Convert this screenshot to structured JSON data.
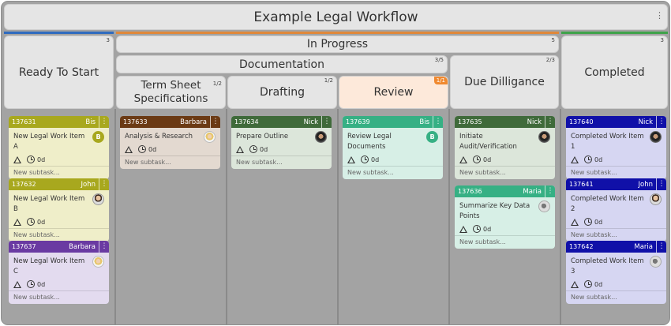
{
  "title": "Example Legal Workflow",
  "title_menu": "⋮",
  "groups": {
    "in_progress": {
      "label": "In Progress",
      "count": "5"
    },
    "documentation": {
      "label": "Documentation",
      "count": "3/5"
    }
  },
  "columns": {
    "ready": {
      "label": "Ready To Start",
      "count": "3"
    },
    "term_sheet": {
      "label": "Term Sheet Specifications",
      "count": "1/2"
    },
    "drafting": {
      "label": "Drafting",
      "count": "1/2"
    },
    "review": {
      "label": "Review",
      "count": "1/1"
    },
    "due_dilligance": {
      "label": "Due Dilligance",
      "count": "2/3"
    },
    "completed": {
      "label": "Completed",
      "count": "3"
    }
  },
  "cards": {
    "c137631": {
      "id": "137631",
      "owner": "Bis",
      "title": "New Legal Work Item A",
      "time": "0d",
      "subtask": "New subtask...",
      "avatar": "B",
      "head_color": "#a8a81e",
      "body_color": "#efeec9"
    },
    "c137632": {
      "id": "137632",
      "owner": "John",
      "title": "New Legal Work Item B",
      "time": "0d",
      "subtask": "New subtask...",
      "head_color": "#a8a81e",
      "body_color": "#efeec9"
    },
    "c137637": {
      "id": "137637",
      "owner": "Barbara",
      "title": "New Legal Work Item C",
      "time": "0d",
      "subtask": "New subtask...",
      "head_color": "#6a3aa2",
      "body_color": "#e3dbef"
    },
    "c137633": {
      "id": "137633",
      "owner": "Barbara",
      "title": "Analysis & Research",
      "time": "0d",
      "subtask": "New subtask...",
      "head_color": "#6b3a14",
      "body_color": "#e3d9d0"
    },
    "c137634": {
      "id": "137634",
      "owner": "Nick",
      "title": "Prepare Outline",
      "time": "0d",
      "subtask": "New subtask...",
      "head_color": "#3f6a3a",
      "body_color": "#dce6da"
    },
    "c137639": {
      "id": "137639",
      "owner": "Bis",
      "title": "Review Legal Documents",
      "time": "0d",
      "subtask": "New subtask...",
      "avatar": "B",
      "head_color": "#36b084",
      "body_color": "#d7efe6"
    },
    "c137635": {
      "id": "137635",
      "owner": "Nick",
      "title": "Initiate Audit/Verification",
      "time": "0d",
      "subtask": "New subtask...",
      "head_color": "#3f6a3a",
      "body_color": "#dce6da"
    },
    "c137636": {
      "id": "137636",
      "owner": "Maria",
      "title": "Summarize Key Data Points",
      "time": "0d",
      "subtask": "New subtask...",
      "head_color": "#36b084",
      "body_color": "#d7efe6"
    },
    "c137640": {
      "id": "137640",
      "owner": "Nick",
      "title": "Completed Work Item 1",
      "time": "0d",
      "subtask": "New subtask...",
      "head_color": "#1010a8",
      "body_color": "#d6d6f2"
    },
    "c137641": {
      "id": "137641",
      "owner": "John",
      "title": "Completed Work Item 2",
      "time": "0d",
      "subtask": "New subtask...",
      "head_color": "#1010a8",
      "body_color": "#d6d6f2"
    },
    "c137642": {
      "id": "137642",
      "owner": "Maria",
      "title": "Completed Work Item 3",
      "time": "0d",
      "subtask": "New subtask...",
      "head_color": "#1010a8",
      "body_color": "#d6d6f2"
    }
  },
  "colors": {
    "ready_bar": "#2f6bbf",
    "in_progress_bar": "#e0883a",
    "completed_bar": "#3fa34a",
    "review_accent": "#f0892f",
    "board_bg": "#a3a3a3"
  },
  "icons": {
    "card_menu": "⋮",
    "priority": "triangle-icon",
    "time": "clock-icon"
  }
}
